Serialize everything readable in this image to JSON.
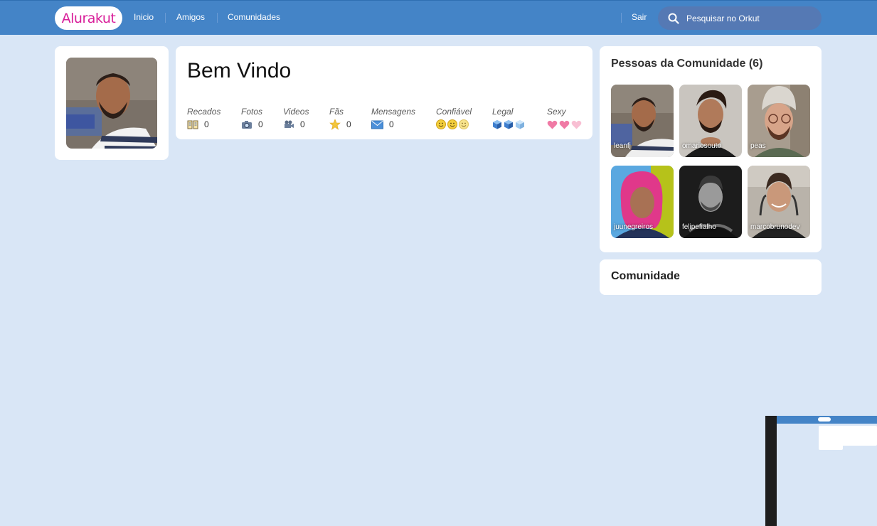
{
  "header": {
    "logo": "Alurakut",
    "nav": [
      "Inicio",
      "Amigos",
      "Comunidades"
    ],
    "logout": "Sair",
    "search_placeholder": "Pesquisar no Orkut"
  },
  "welcome": {
    "title": "Bem Vindo",
    "stats": [
      {
        "label": "Recados",
        "value": "0",
        "icon": "book-icon"
      },
      {
        "label": "Fotos",
        "value": "0",
        "icon": "camera-icon"
      },
      {
        "label": "Videos",
        "value": "0",
        "icon": "video-camera-icon"
      },
      {
        "label": "Fãs",
        "value": "0",
        "icon": "star-icon"
      },
      {
        "label": "Mensagens",
        "value": "0",
        "icon": "envelope-icon"
      }
    ],
    "ratings": [
      {
        "label": "Confiável",
        "icon": "smiley-icon",
        "count": 3
      },
      {
        "label": "Legal",
        "icon": "cube-icon",
        "count": 3
      },
      {
        "label": "Sexy",
        "icon": "heart-icon",
        "count": 3
      }
    ]
  },
  "community_people": {
    "title": "Pessoas da Comunidade (6)",
    "people": [
      "leanfj",
      "omariosouto",
      "peas",
      "juunegreiros",
      "felipefialho",
      "marcobrunodev"
    ]
  },
  "community": {
    "title": "Comunidade"
  },
  "colors": {
    "background": "#d9e6f6",
    "topbar": "#4484c7",
    "logo_text": "#d81d99",
    "search_bg": "#5579b4"
  }
}
